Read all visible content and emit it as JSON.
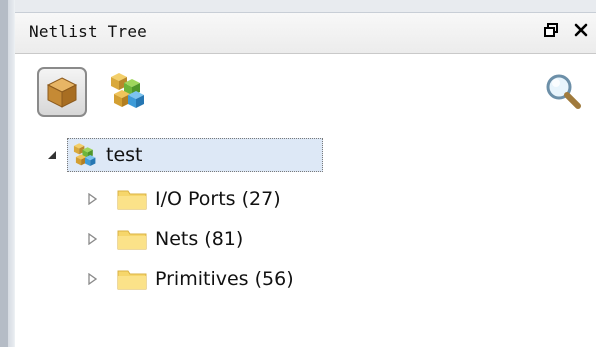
{
  "panel": {
    "title": "Netlist Tree",
    "restore_icon": "restore-window-icon",
    "close_icon": "close-icon"
  },
  "toolbar": {
    "buttons": [
      {
        "icon": "single-cube-icon",
        "pressed": true
      },
      {
        "icon": "multi-cubes-icon",
        "pressed": false
      },
      {
        "icon": "search-icon",
        "pressed": false
      }
    ]
  },
  "tree": {
    "root": {
      "label": "test",
      "expanded": true,
      "icon": "design-cubes-icon",
      "selected": true
    },
    "children": [
      {
        "label": "I/O Ports (27)",
        "icon": "folder-icon",
        "expanded": false
      },
      {
        "label": "Nets (81)",
        "icon": "folder-icon",
        "expanded": false
      },
      {
        "label": "Primitives (56)",
        "icon": "folder-icon",
        "expanded": false
      }
    ]
  },
  "colors": {
    "selection": "#dde8f6",
    "folder": "#f6d66b",
    "window_border": "#b5bcc6"
  }
}
